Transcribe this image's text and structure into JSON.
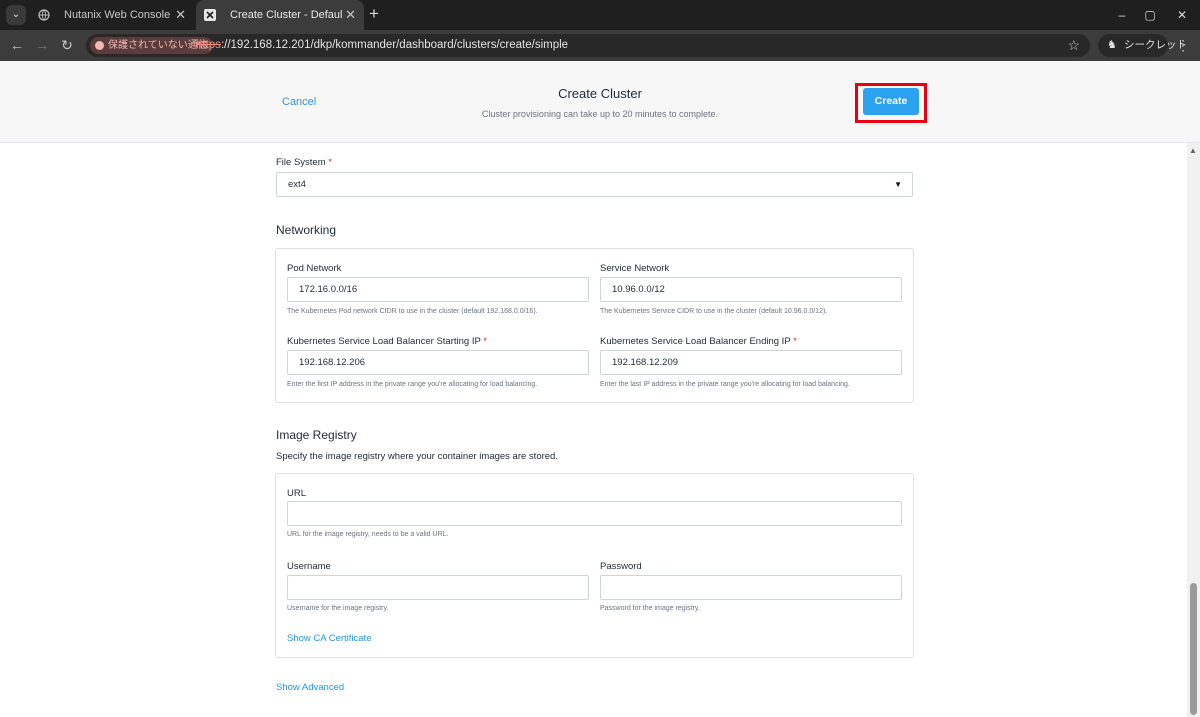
{
  "browser": {
    "tabs": [
      {
        "title": "Nutanix Web Console"
      },
      {
        "title": "Create Cluster - Default Worksp"
      }
    ],
    "security_label": "保護されていない通信",
    "url_scheme": "https",
    "url_rest": "://192.168.12.201/dkp/kommander/dashboard/clusters/create/simple",
    "incognito_label": "シークレット"
  },
  "header": {
    "cancel_label": "Cancel",
    "title": "Create Cluster",
    "subtitle": "Cluster provisioning can take up to 20 minutes to complete.",
    "create_label": "Create"
  },
  "filesystem": {
    "label": "File System",
    "required": "*",
    "value": "ext4"
  },
  "networking": {
    "heading": "Networking",
    "pod_network": {
      "label": "Pod Network",
      "value": "172.16.0.0/16",
      "help": "The Kubernetes Pod network CIDR to use in the cluster (default 192.168.0.0/16)."
    },
    "service_network": {
      "label": "Service Network",
      "value": "10.96.0.0/12",
      "help": "The Kubernetes Service CIDR to use in the cluster (default 10.96.0.0/12)."
    },
    "lb_start": {
      "label": "Kubernetes Service Load Balancer Starting IP",
      "value": "192.168.12.206",
      "help": "Enter the first IP address in the private range you're allocating for load balancing."
    },
    "lb_end": {
      "label": "Kubernetes Service Load Balancer Ending IP",
      "value": "192.168.12.209",
      "help": "Enter the last IP address in the private range you're allocating for load balancing."
    }
  },
  "registry": {
    "heading": "Image Registry",
    "description": "Specify the image registry where your container images are stored.",
    "url": {
      "label": "URL",
      "value": "",
      "help": "URL for the image registry, needs to be a valid URL."
    },
    "username": {
      "label": "Username",
      "value": "",
      "help": "Username for the image registry."
    },
    "password": {
      "label": "Password",
      "value": "",
      "help": "Password for the image registry."
    },
    "show_ca_label": "Show CA Certificate"
  },
  "show_advanced_label": "Show Advanced",
  "colors": {
    "accent": "#2396e6",
    "create_button": "#2aa2ef",
    "highlight_border": "#e8000f",
    "required": "#e02424"
  },
  "icons": [
    "tab-list-icon",
    "globe-icon",
    "nkp-logo-icon",
    "close-icon",
    "plus-icon",
    "minimize-icon",
    "maximize-icon",
    "back-icon",
    "forward-icon",
    "reload-icon",
    "warning-icon",
    "star-icon",
    "incognito-icon",
    "kebab-menu-icon",
    "caret-down-icon"
  ]
}
